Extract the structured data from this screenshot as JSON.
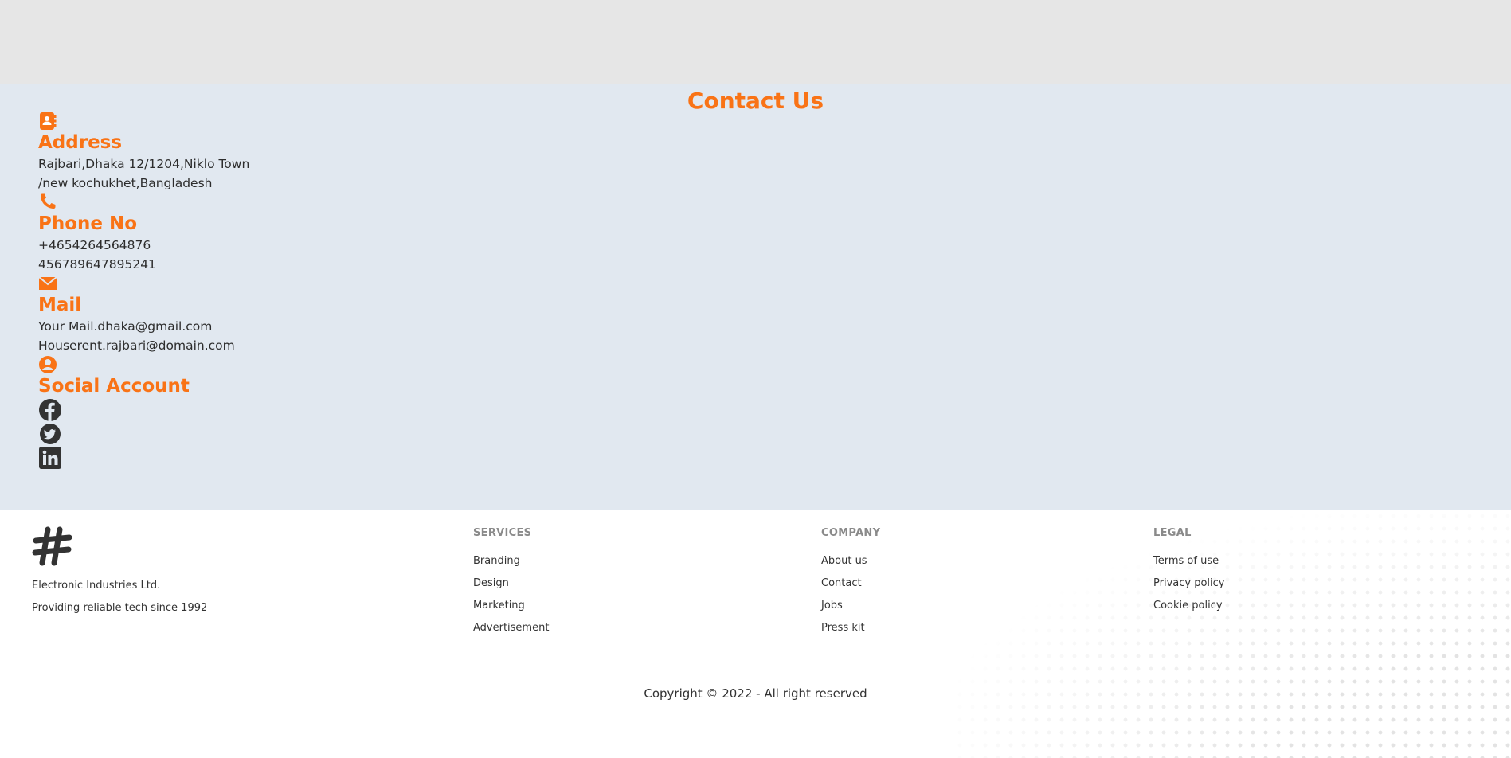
{
  "contact": {
    "title": "Contact Us",
    "address": {
      "heading": "Address",
      "lines": [
        "Rajbari,Dhaka 12/1204,Niklo Town",
        "/new kochukhet,Bangladesh"
      ]
    },
    "phone": {
      "heading": "Phone No",
      "lines": [
        "+4654264564876",
        "456789647895241"
      ]
    },
    "mail": {
      "heading": "Mail",
      "lines": [
        "Your Mail.dhaka@gmail.com",
        "Houserent.rajbari@domain.com"
      ]
    },
    "social": {
      "heading": "Social Account",
      "icons": [
        "facebook-icon",
        "twitter-icon",
        "linkedin-icon"
      ]
    },
    "accent": "#f97316"
  },
  "footer": {
    "company_name": "Electronic Industries Ltd.",
    "tagline": "Providing reliable tech since 1992",
    "services": {
      "heading": "SERVICES",
      "links": [
        "Branding",
        "Design",
        "Marketing",
        "Advertisement"
      ]
    },
    "company": {
      "heading": "COMPANY",
      "links": [
        "About us",
        "Contact",
        "Jobs",
        "Press kit"
      ]
    },
    "legal": {
      "heading": "LEGAL",
      "links": [
        "Terms of use",
        "Privacy policy",
        "Cookie policy"
      ]
    },
    "copyright": "Copyright © 2022 - All right reserved"
  }
}
